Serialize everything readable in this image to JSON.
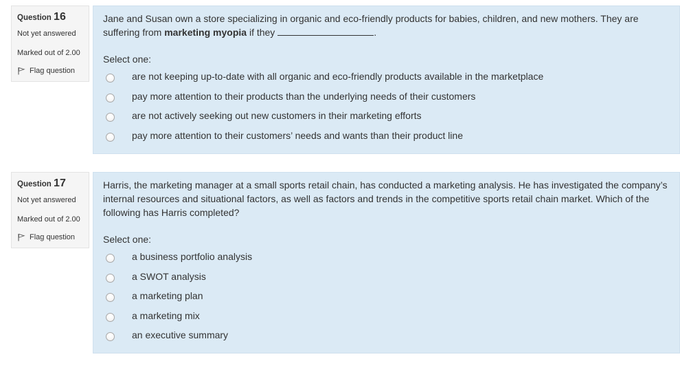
{
  "questions": [
    {
      "label": "Question",
      "number": "16",
      "state": "Not yet answered",
      "grade": "Marked out of 2.00",
      "flag_label": "Flag question",
      "text_part1": "Jane and Susan own a store specializing in organic and eco-friendly products for babies, children, and new mothers. They are suffering from ",
      "text_bold": "marketing myopia",
      "text_part2": " if they ",
      "text_end": ".",
      "prompt": "Select one:",
      "answers": [
        "are not keeping up-to-date with all organic and eco-friendly products available in the marketplace",
        "pay more attention to their products than the underlying needs of their customers",
        "are not actively seeking out new customers in their marketing efforts",
        "pay more attention to their customers’ needs and wants than their product line"
      ]
    },
    {
      "label": "Question",
      "number": "17",
      "state": "Not yet answered",
      "grade": "Marked out of 2.00",
      "flag_label": "Flag question",
      "text": "Harris, the marketing manager at a small sports retail chain, has conducted a marketing analysis. He has investigated the company’s internal resources and situational factors, as well as factors and trends in the competitive sports retail chain market. Which of the following has Harris completed?",
      "prompt": "Select one:",
      "answers": [
        "a business portfolio analysis",
        "a SWOT analysis",
        "a marketing plan",
        "a marketing mix",
        "an executive summary"
      ]
    }
  ],
  "icons": {
    "flag": "flag-icon",
    "radio": "radio-button"
  },
  "colors": {
    "content_bg": "#dbeaf5",
    "info_bg": "#f5f5f5",
    "text": "#333333"
  }
}
